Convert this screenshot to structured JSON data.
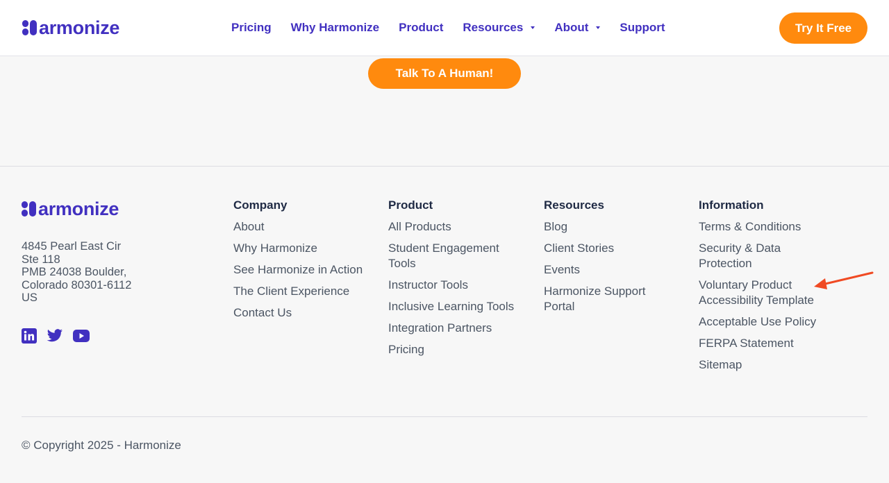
{
  "brand": {
    "name": "armonize",
    "color": "#4130c0"
  },
  "nav": {
    "items": [
      {
        "label": "Pricing",
        "dropdown": false
      },
      {
        "label": "Why Harmonize",
        "dropdown": false
      },
      {
        "label": "Product",
        "dropdown": false
      },
      {
        "label": "Resources",
        "dropdown": true
      },
      {
        "label": "About",
        "dropdown": true
      },
      {
        "label": "Support",
        "dropdown": false
      }
    ],
    "cta_label": "Try It Free"
  },
  "hero": {
    "cta_label": "Talk To A Human!"
  },
  "footer": {
    "address": [
      "4845 Pearl East Cir",
      "Ste 118",
      "PMB 24038 Boulder,",
      "Colorado 80301-6112",
      "US"
    ],
    "social": [
      "linkedin-icon",
      "twitter-icon",
      "youtube-icon"
    ],
    "columns": [
      {
        "title": "Company",
        "links": [
          "About",
          "Why Harmonize",
          "See Harmonize in Action",
          "The Client Experience",
          "Contact Us"
        ]
      },
      {
        "title": "Product",
        "links": [
          "All Products",
          "Student Engagement Tools",
          "Instructor Tools",
          "Inclusive Learning Tools",
          "Integration Partners",
          "Pricing"
        ]
      },
      {
        "title": "Resources",
        "links": [
          "Blog",
          "Client Stories",
          "Events",
          "Harmonize Support Portal"
        ]
      },
      {
        "title": "Information",
        "links": [
          "Terms & Conditions",
          "Security & Data Protection",
          "Voluntary Product Accessibility Template",
          "Acceptable Use Policy",
          "FERPA Statement",
          "Sitemap"
        ]
      }
    ],
    "copyright": "© Copyright 2025 - Harmonize"
  },
  "annotation": {
    "icon": "arrow-icon",
    "color": "#f04a23"
  },
  "colors": {
    "accent": "#ff8a0e",
    "brand": "#4130c0",
    "background": "#f7f7f7"
  }
}
